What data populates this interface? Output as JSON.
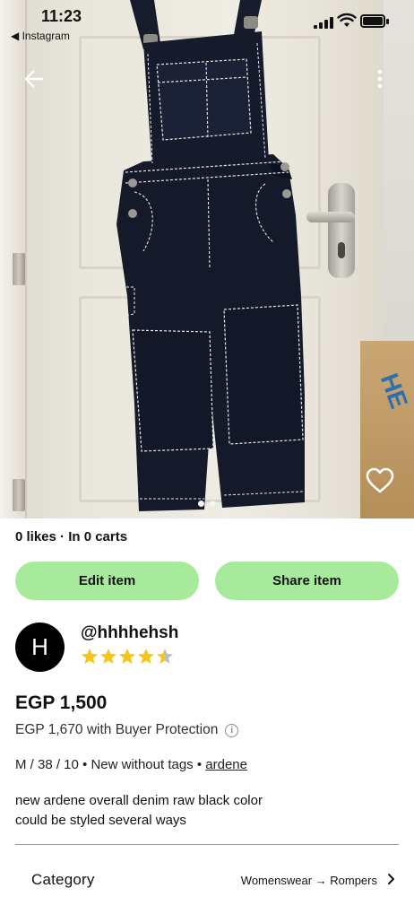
{
  "status_bar": {
    "time": "11:23",
    "back_app": "◀ Instagram"
  },
  "icons": {
    "back": "arrow-left-icon",
    "more": "more-vertical-icon",
    "favorite": "heart-icon",
    "info": "info-icon",
    "chevron": "chevron-right-icon"
  },
  "photo": {
    "page_count": 2,
    "active_page": 1
  },
  "item": {
    "stats": "0 likes · In 0 carts",
    "edit_label": "Edit item",
    "share_label": "Share item",
    "price": "EGP 1,500",
    "price_with_protection": "EGP 1,670 with Buyer Protection",
    "details_prefix": "M / 38 / 10 • New without tags •",
    "brand": "ardene",
    "description_line1": "new ardene overall denim raw black color",
    "description_line2": "could be styled several ways"
  },
  "seller": {
    "avatar_letter": "H",
    "username": "@hhhhehsh",
    "rating": 4.5,
    "rating_max": 5
  },
  "category": {
    "label": "Category",
    "path": "Womenswear → Rompers"
  },
  "colors": {
    "accent_green": "#a7ea9b",
    "star_yellow": "#f5c518",
    "star_empty": "#bdbdbd",
    "denim": "#161b2c"
  }
}
